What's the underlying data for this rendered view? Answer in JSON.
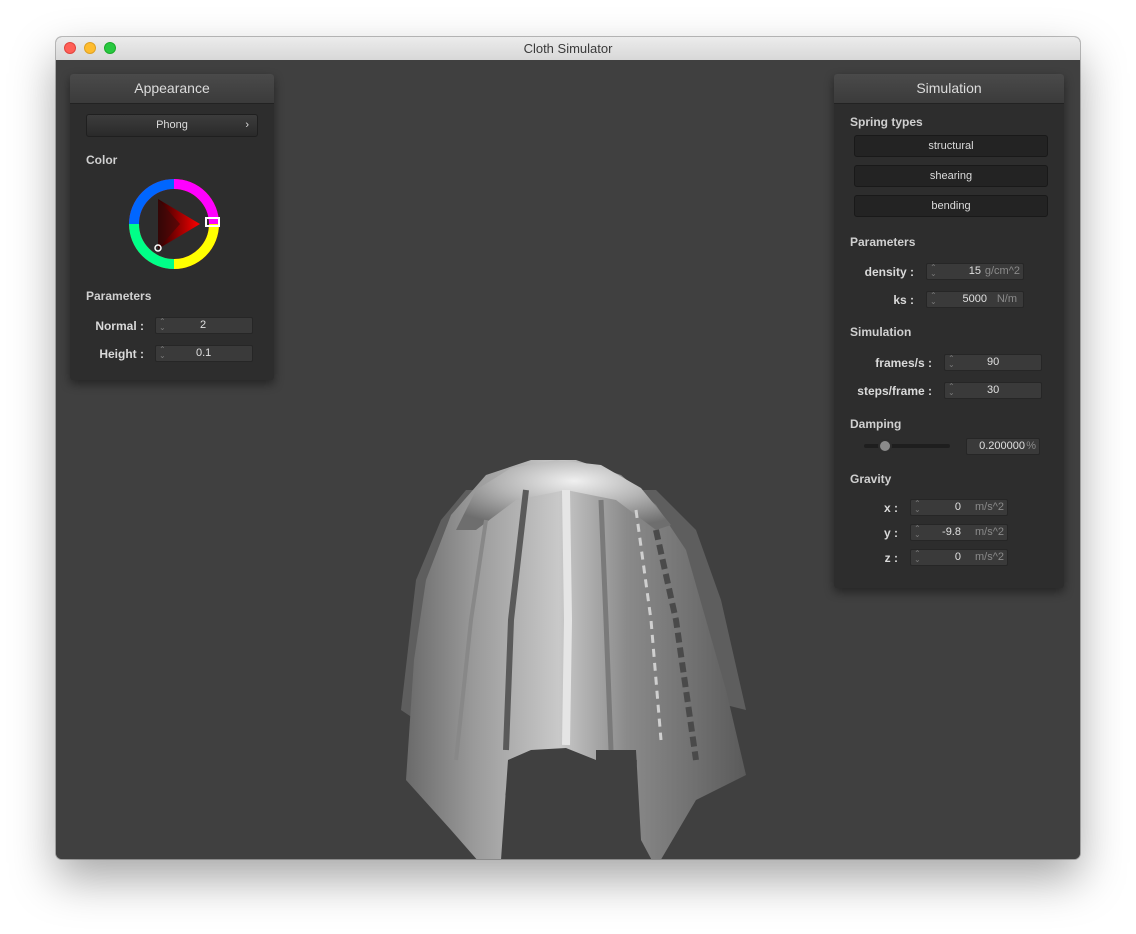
{
  "window": {
    "title": "Cloth Simulator"
  },
  "appearance": {
    "header": "Appearance",
    "shader_select": {
      "value": "Phong",
      "chevron": "›"
    },
    "color_label": "Color",
    "color_picker": {
      "hue_color": "#ff0000"
    },
    "params_label": "Parameters",
    "normal": {
      "label": "Normal :",
      "value": "2"
    },
    "height": {
      "label": "Height :",
      "value": "0.1"
    }
  },
  "simulation": {
    "header": "Simulation",
    "spring_types_label": "Spring types",
    "spring_types": [
      "structural",
      "shearing",
      "bending"
    ],
    "params_label": "Parameters",
    "density": {
      "label": "density :",
      "value": "15",
      "unit": "g/cm^2"
    },
    "ks": {
      "label": "ks :",
      "value": "5000",
      "unit": "N/m"
    },
    "sim_label": "Simulation",
    "frames": {
      "label": "frames/s :",
      "value": "90"
    },
    "steps": {
      "label": "steps/frame :",
      "value": "30"
    },
    "damping_label": "Damping",
    "damping": {
      "value": "0.200000",
      "unit": "%",
      "slider_fraction": 0.2
    },
    "gravity_label": "Gravity",
    "gravity": [
      {
        "label": "x :",
        "value": "0",
        "unit": "m/s^2"
      },
      {
        "label": "y :",
        "value": "-9.8",
        "unit": "m/s^2"
      },
      {
        "label": "z :",
        "value": "0",
        "unit": "m/s^2"
      }
    ]
  },
  "colors": {
    "accent": "#ff0000",
    "panel_bg": "#2d2d2d",
    "viewport_bg": "#404040"
  }
}
